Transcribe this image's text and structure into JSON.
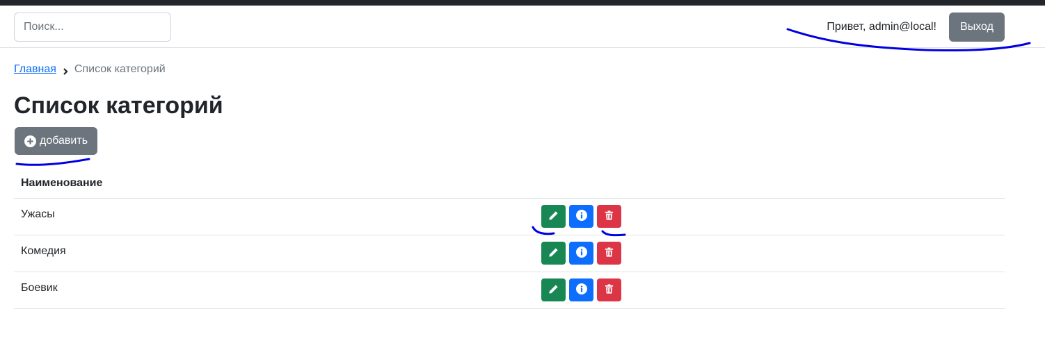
{
  "header": {
    "search_placeholder": "Поиск...",
    "greeting": "Привет, admin@local!",
    "logout_label": "Выход"
  },
  "breadcrumb": {
    "home": "Главная",
    "current": "Список категорий"
  },
  "page": {
    "title": "Список категорий",
    "add_label": "добавить"
  },
  "table": {
    "header": "Наименование",
    "rows": [
      {
        "name": "Ужасы"
      },
      {
        "name": "Комедия"
      },
      {
        "name": "Боевик"
      }
    ],
    "actions": [
      "pencil-icon",
      "info-icon",
      "trash-icon"
    ]
  },
  "colors": {
    "edit": "#198754",
    "info": "#0d6efd",
    "delete": "#dc3545",
    "secondary": "#6c757d",
    "annotation": "#0000e0"
  }
}
